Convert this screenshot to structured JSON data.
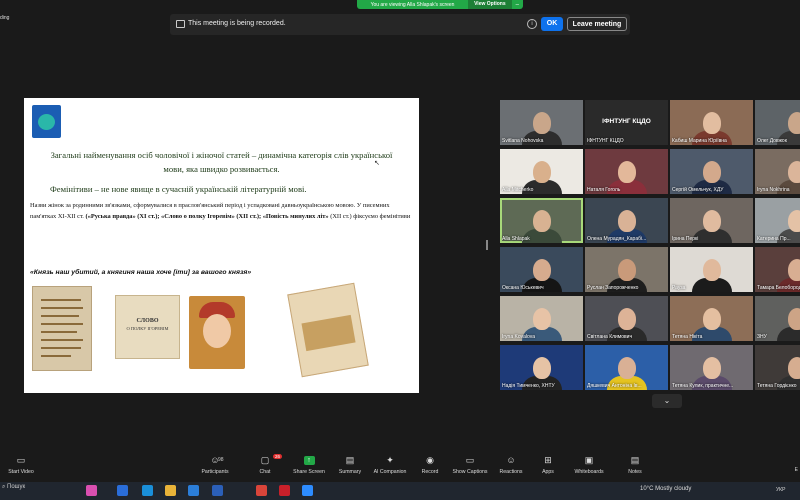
{
  "top_banner": {
    "message": "You are viewing Alla Shlapak's screen",
    "view_options": "View Options",
    "minimize_glyph": "–"
  },
  "top_left_fragment": "ding",
  "recording_bar": {
    "text": "This meeting is being recorded.",
    "info_glyph": "i",
    "ok_label": "OK",
    "leave_label": "Leave meeting"
  },
  "slide": {
    "heading": "Загальні найменування осіб чоловічої і жіночої статей – динамічна категорія слів української мови, яка швидко розвивається.",
    "feminitives": "Фемінітиви – не нове явище в сучасній українській літературній мові.",
    "paragraph_intro": "Назви жінок за родинними зв'язками, сформувалися в праслов'янський період і успадковані давньоукраїнською мовою. У писемних пам'ятках ХІ-ХІІ ст. ",
    "paragraph_bold1": "(«Руська правда» (ХІ ст.); «Слово о полку Ігоревім» (ХІІ ст.); «Повість минулих літ»",
    "paragraph_end": " (ХІІ ст.) фіксуємо фемінітиви",
    "quote": "«Князь наш убитий, а княгиня наша хоче [іти] за вашого князя»",
    "book_title_line1": "СЛОВО",
    "book_title_line2": "О ПОЛКУ ІГОРЕВІМ"
  },
  "gallery": {
    "tiles": [
      {
        "name": "Svitlana Nohovska",
        "bg": "#6b6f73",
        "skin": "#c9a68a",
        "shirt": "#2d2d2d"
      },
      {
        "name": "ІФНТУНГ КЦДО",
        "bg": "#2a2a2a",
        "label": "ІФНТУНГ КЦДО"
      },
      {
        "name": "Кабиш Марина Юріївна",
        "bg": "#8b6b55",
        "skin": "#e2bda0",
        "shirt": "#7a3a2e"
      },
      {
        "name": "Олег Довжок",
        "bg": "#5d6367",
        "skin": "#c9a68a",
        "shirt": "#3a3a3a"
      },
      {
        "name": "Alla Mitcherko",
        "bg": "#ece9e3",
        "skin": "#d9b08c",
        "shirt": "#2b2b2b"
      },
      {
        "name": "Наталя Гоголь",
        "bg": "#6e3a3f",
        "skin": "#e3b89a",
        "shirt": "#8a2f3b"
      },
      {
        "name": "Сергій Омельчук, ХДУ",
        "bg": "#4e5a6b",
        "skin": "#d3a98c",
        "shirt": "#1e2a44"
      },
      {
        "name": "Iryna Nokhrina",
        "bg": "#7a6c61",
        "skin": "#dbb59a",
        "shirt": "#5b4a3e"
      },
      {
        "name": "Alla Shlapak",
        "bg": "#5e6a55",
        "skin": "#d8b292",
        "shirt": "#3b4a3a"
      },
      {
        "name": "Олена Мурадян_Карабі...",
        "bg": "#3b4652",
        "skin": "#d9b296",
        "shirt": "#1f3a66"
      },
      {
        "name": "Ірина Перкі",
        "bg": "#6e6660",
        "skin": "#e0bb9f",
        "shirt": "#2f2f2f"
      },
      {
        "name": "Катерина Пр...",
        "bg": "#9aa0a3",
        "skin": "#e4c2a6",
        "shirt": "#4b4b4b"
      },
      {
        "name": "Оксана Юськевич",
        "bg": "#3a4a5c",
        "skin": "#d6ab8e",
        "shirt": "#151515"
      },
      {
        "name": "Руслан Запорожченко",
        "bg": "#7c7469",
        "skin": "#c99a7a",
        "shirt": "#1e1e1e"
      },
      {
        "name": "Рауза",
        "bg": "#dedad4",
        "skin": "#e0b99c",
        "shirt": "#1b1b1b"
      },
      {
        "name": "Тамара Белобородова",
        "bg": "#5a3f3c",
        "skin": "#d8ae92",
        "shirt": "#6b2a2a"
      },
      {
        "name": "Iryna Kovalova",
        "bg": "#b9b3a6",
        "skin": "#e7c3a6",
        "shirt": "#3a5a7a"
      },
      {
        "name": "Світлана Климович",
        "bg": "#4e4f55",
        "skin": "#ddb397",
        "shirt": "#2a2a2a"
      },
      {
        "name": "Тетяна Нікіта",
        "bg": "#8d6e57",
        "skin": "#e4bfa0",
        "shirt": "#2e4a6b"
      },
      {
        "name": "ЗНУ",
        "bg": "#5f605e",
        "skin": "#cda486",
        "shirt": "#2b2b2b"
      },
      {
        "name": "Надія Тимченко, ХНТУ",
        "bg": "#1e3a78",
        "skin": "#e6c3a5",
        "shirt": "#222"
      },
      {
        "name": "Дяшкевич Антоніна Ів...",
        "bg": "#2c5fa8",
        "skin": "#d9b095",
        "shirt": "#e5c320"
      },
      {
        "name": "Тетяна Кулик, практичне...",
        "bg": "#6f6a70",
        "skin": "#e4bfa2",
        "shirt": "#5a4a6a"
      },
      {
        "name": "Тетяна Гордієнко",
        "bg": "#3f3a38",
        "skin": "#d6ad90",
        "shirt": "#2f2f2f"
      }
    ]
  },
  "toolbar": {
    "start_video": "Start Video",
    "participants": "Participants",
    "participants_count": "98",
    "chat": "Chat",
    "chat_badge": "26",
    "share": "Share Screen",
    "summary": "Summary",
    "ai": "AI Companion",
    "record": "Record",
    "captions": "Show Captions",
    "reactions": "Reactions",
    "apps": "Apps",
    "whiteboards": "Whiteboards",
    "notes": "Notes",
    "end_fragment": "E"
  },
  "taskbar": {
    "search": "Пошук",
    "weather": "10°C  Mostly cloudy",
    "lang": "УКР",
    "apps": [
      {
        "name": "copilot",
        "color": "#d94fb0"
      },
      {
        "name": "widgets",
        "color": "#2a6dd9"
      },
      {
        "name": "edge",
        "color": "#1a8fd9"
      },
      {
        "name": "explorer",
        "color": "#e8b339"
      },
      {
        "name": "store",
        "color": "#2b7ed9"
      },
      {
        "name": "word",
        "color": "#2b5fb8"
      },
      {
        "name": "chrome",
        "color": "#d9453a"
      },
      {
        "name": "acrobat",
        "color": "#c8202a"
      },
      {
        "name": "zoom",
        "color": "#2d8cff"
      }
    ]
  },
  "colors": {
    "accent": "#0e72ed",
    "green": "#22a847",
    "highlight": "#a8d97a"
  }
}
